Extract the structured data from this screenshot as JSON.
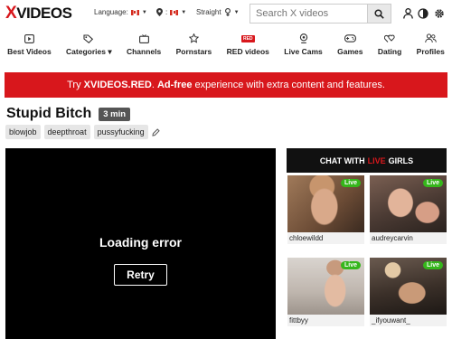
{
  "header": {
    "logo_x": "X",
    "logo_text": "VIDEOS",
    "language_label": "Language:",
    "country_label": "📍:",
    "orientation_label": "Straight",
    "search_placeholder": "Search X videos"
  },
  "nav": [
    {
      "label": "Best Videos",
      "icon": "play-box-icon"
    },
    {
      "label": "Categories ▾",
      "icon": "tags-icon"
    },
    {
      "label": "Channels",
      "icon": "tv-icon"
    },
    {
      "label": "Pornstars",
      "icon": "star-icon"
    },
    {
      "label": "RED videos",
      "icon": "red-badge-icon",
      "badge": "RED"
    },
    {
      "label": "Live Cams",
      "icon": "webcam-icon"
    },
    {
      "label": "Games",
      "icon": "gamepad-icon"
    },
    {
      "label": "Dating",
      "icon": "hearts-icon"
    },
    {
      "label": "Profiles",
      "icon": "users-icon"
    }
  ],
  "banner": {
    "pre": "Try ",
    "brand": "XVIDEOS.RED",
    "mid": ". ",
    "adfree": "Ad-free",
    "post": " experience with extra content and features."
  },
  "video": {
    "title": "Stupid Bitch",
    "duration": "3 min",
    "tags": [
      "blowjob",
      "deepthroat",
      "pussyfucking"
    ],
    "error_text": "Loading error",
    "retry_label": "Retry"
  },
  "chat": {
    "pre": "CHAT WITH",
    "live": "LIVE",
    "post": "GIRLS",
    "live_badge": "Live",
    "cams": [
      {
        "name": "chloewildd"
      },
      {
        "name": "audreycarvin"
      },
      {
        "name": "fittbyy"
      },
      {
        "name": "_ifyouwant_"
      }
    ]
  },
  "colors": {
    "brand_red": "#d8171c",
    "live_green": "#35b61b"
  }
}
